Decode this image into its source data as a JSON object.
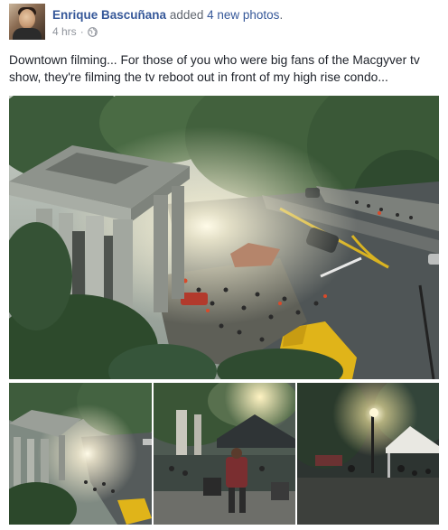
{
  "post": {
    "author": "Enrique Bascuñana",
    "action_prefix": "added",
    "action_link": "4 new photos",
    "action_suffix": ".",
    "timestamp": "4 hrs",
    "separator": "·",
    "privacy_icon": "globe-icon",
    "text": "Downtown filming... For those of you who were big fans of the Macgyver tv show, they're filming the tv reboot out in front of my high rise condo..."
  },
  "photos": [
    {
      "name": "main-photo"
    },
    {
      "name": "thumbnail-1"
    },
    {
      "name": "thumbnail-2"
    },
    {
      "name": "thumbnail-3"
    }
  ],
  "colors": {
    "author_link": "#365899",
    "meta_gray": "#90949c",
    "body_text": "#1d2129"
  }
}
